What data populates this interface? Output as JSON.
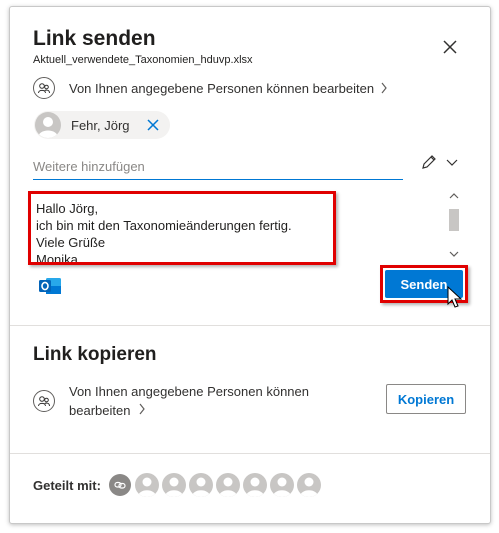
{
  "dialog": {
    "title": "Link senden",
    "filename": "Aktuell_verwendete_Taxonomien_hduvp.xlsx",
    "close_icon": "close-icon"
  },
  "permission": {
    "icon": "people-icon",
    "text": "Von Ihnen angegebene Personen können bearbeiten"
  },
  "recipient": {
    "name": "Fehr, Jörg",
    "avatar_icon": "person-avatar-icon",
    "remove_icon": "remove-icon"
  },
  "add_field": {
    "placeholder": "Weitere hinzufügen",
    "edit_icon": "pencil-icon"
  },
  "message": {
    "text": "Hallo Jörg,\nich bin mit den Taxonomieänderungen fertig.\nViele Grüße\nMonika"
  },
  "send": {
    "label": "Senden",
    "outlook_icon": "outlook-icon"
  },
  "copy_section": {
    "title": "Link kopieren",
    "permission_text": "Von Ihnen angegebene Personen können bearbeiten",
    "button_label": "Kopieren"
  },
  "shared": {
    "label": "Geteilt mit:",
    "avatar_count": 7
  },
  "colors": {
    "accent": "#0078d4",
    "highlight": "#e00000",
    "chip_bg": "#f3f2f1"
  }
}
